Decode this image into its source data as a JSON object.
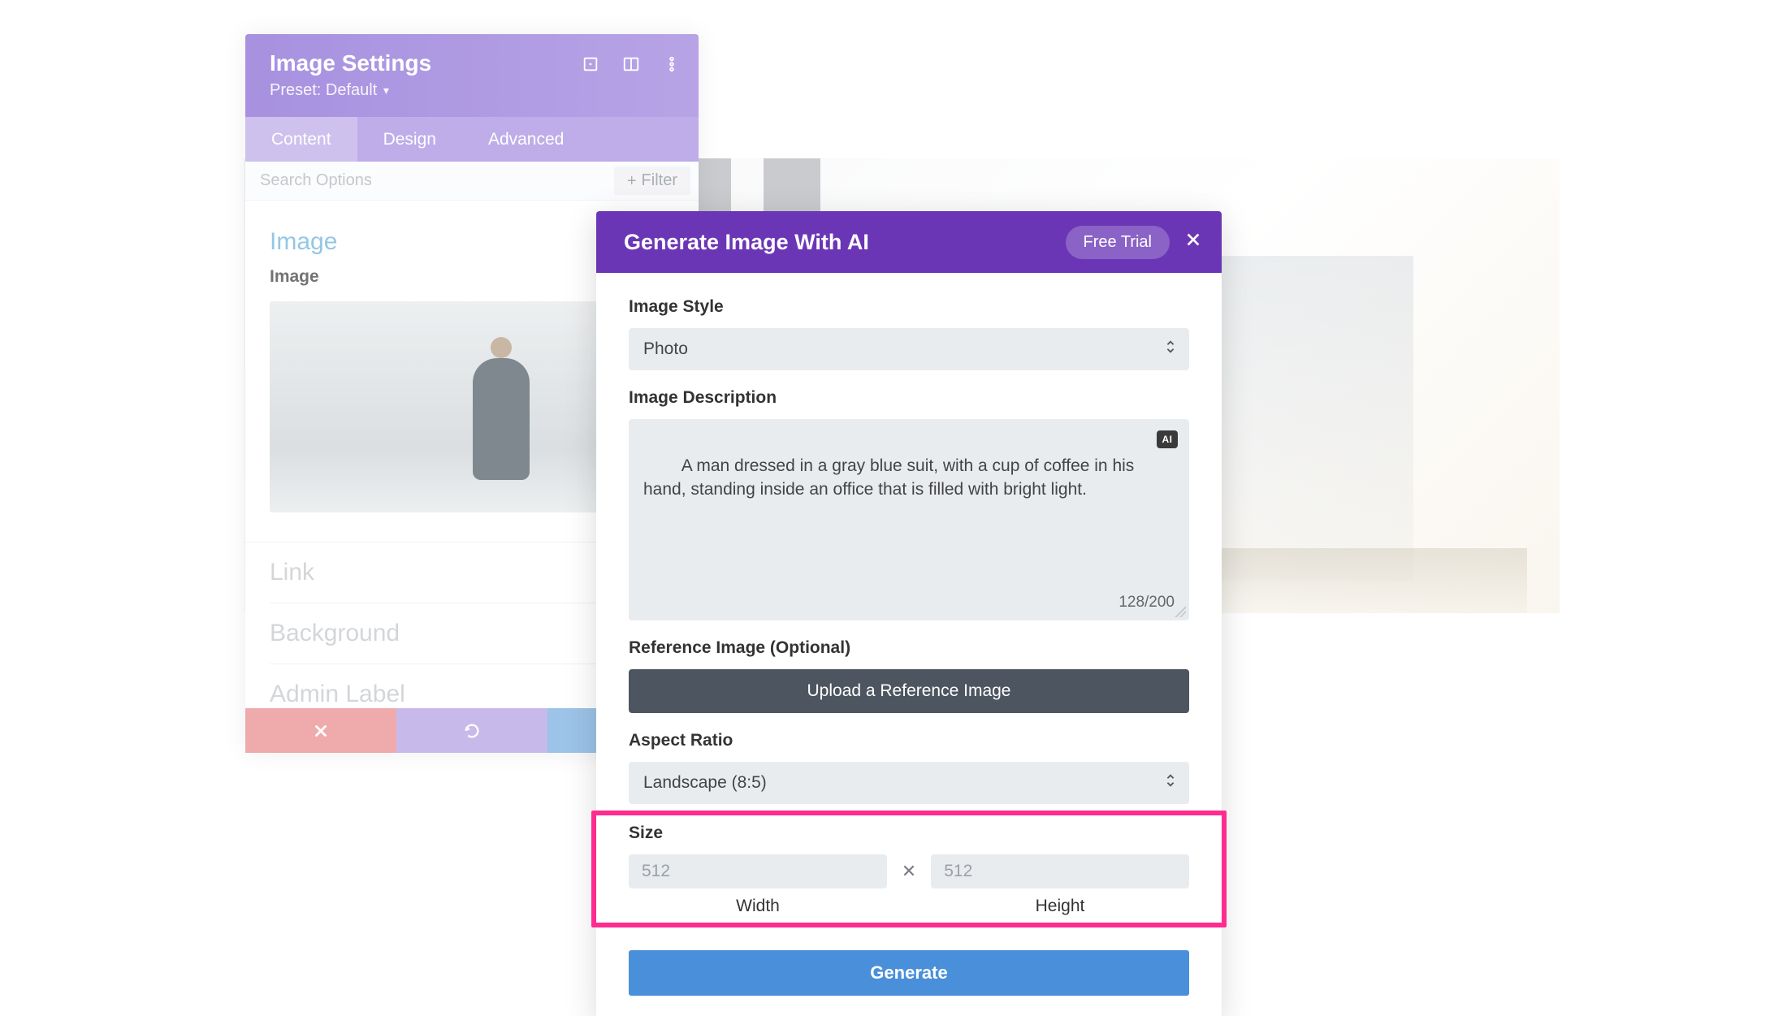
{
  "settings": {
    "title": "Image Settings",
    "preset_label": "Preset:",
    "preset_value": "Default",
    "tabs": {
      "content": "Content",
      "design": "Design",
      "advanced": "Advanced"
    },
    "search_placeholder": "Search Options",
    "filter_label": "Filter",
    "sections": {
      "image_heading": "Image",
      "image_field_label": "Image",
      "link": "Link",
      "background": "Background",
      "admin_label": "Admin Label"
    }
  },
  "ai": {
    "title": "Generate Image With AI",
    "free_trial": "Free Trial",
    "labels": {
      "image_style": "Image Style",
      "image_description": "Image Description",
      "reference": "Reference Image (Optional)",
      "aspect_ratio": "Aspect Ratio",
      "size": "Size",
      "width": "Width",
      "height": "Height"
    },
    "image_style_value": "Photo",
    "description_value": "A man dressed in a gray blue suit, with a cup of coffee in his hand, standing inside an office that is filled with bright light.",
    "char_count": "128/200",
    "ai_chip": "AI",
    "upload_label": "Upload a Reference Image",
    "aspect_ratio_value": "Landscape (8:5)",
    "width_placeholder": "512",
    "height_placeholder": "512",
    "generate": "Generate"
  }
}
